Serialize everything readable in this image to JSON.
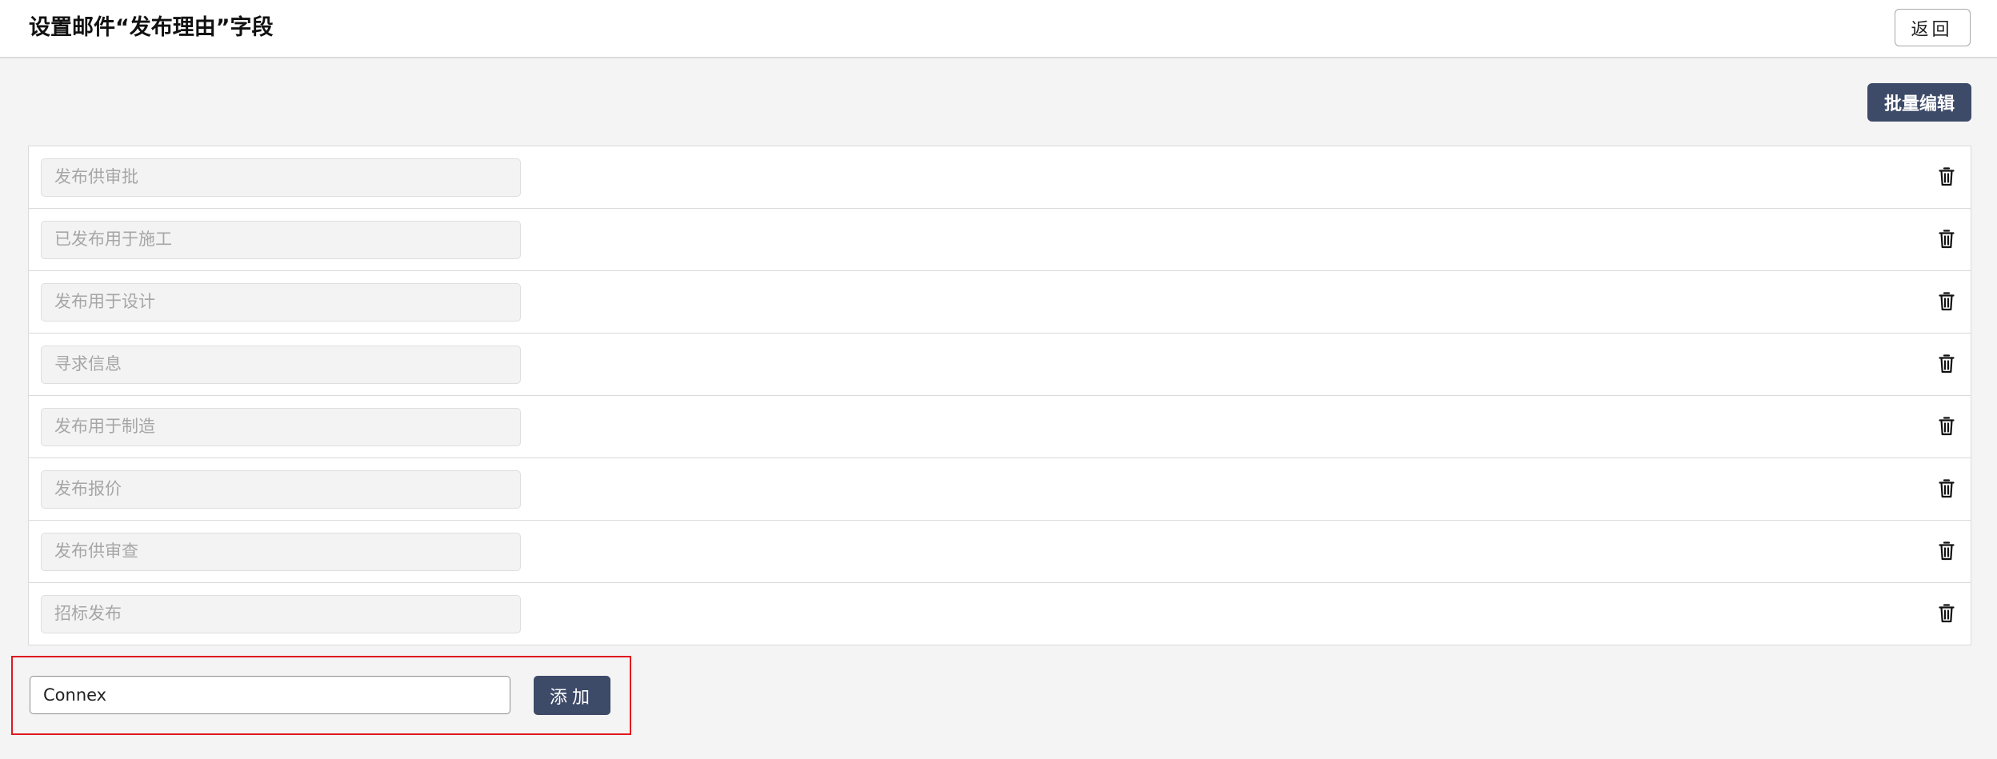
{
  "header": {
    "title": "设置邮件“发布理由”字段",
    "back_label": "返回"
  },
  "toolbar": {
    "batch_edit_label": "批量编辑"
  },
  "reasons": [
    {
      "placeholder": "发布供审批"
    },
    {
      "placeholder": "已发布用于施工"
    },
    {
      "placeholder": "发布用于设计"
    },
    {
      "placeholder": "寻求信息"
    },
    {
      "placeholder": "发布用于制造"
    },
    {
      "placeholder": "发布报价"
    },
    {
      "placeholder": "发布供审查"
    },
    {
      "placeholder": "招标发布"
    }
  ],
  "add_form": {
    "input_value": "Connex",
    "add_label": "添加"
  },
  "icons": {
    "delete": "trash-icon"
  },
  "colors": {
    "primary_button": "#3d4a68",
    "highlight_border": "#e0191f",
    "background": "#f4f4f4"
  }
}
